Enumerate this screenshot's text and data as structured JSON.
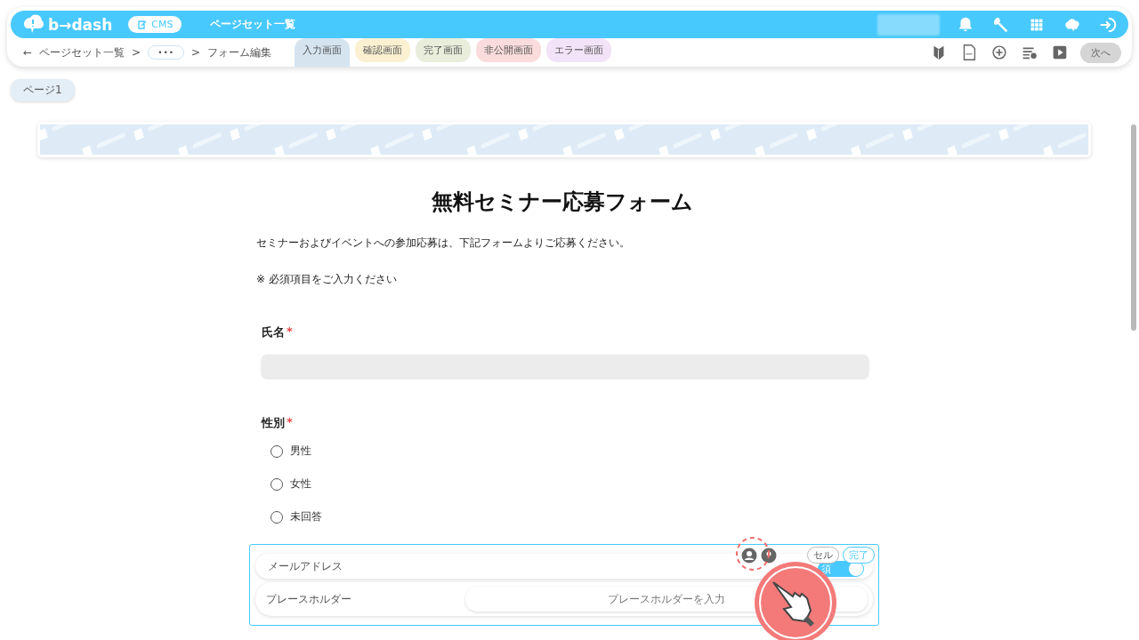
{
  "app_bar": {
    "logo": "b→dash",
    "cms_badge": "CMS",
    "title": "ページセット一覧"
  },
  "breadcrumb": {
    "back": "←",
    "items": [
      {
        "label": "ページセット一覧",
        "kind": "link"
      },
      {
        "label": "•••",
        "kind": "more"
      },
      {
        "label": "フォーム編集",
        "kind": "current"
      }
    ],
    "separator": ">"
  },
  "screen_tabs": [
    {
      "label": "入力画面",
      "selected": true,
      "color": "#d6e4f0"
    },
    {
      "label": "確認画面",
      "selected": false,
      "color": "#fbf1d2"
    },
    {
      "label": "完了画面",
      "selected": false,
      "color": "#e9eedc"
    },
    {
      "label": "非公開画面",
      "selected": false,
      "color": "#fbdcdc"
    },
    {
      "label": "エラー画面",
      "selected": false,
      "color": "#f3e3f8"
    }
  ],
  "next_button": {
    "label": "次へ",
    "disabled": true
  },
  "page_tabs": [
    {
      "label": "ページ1",
      "selected": true
    }
  ],
  "form": {
    "title": "無料セミナー応募フォーム",
    "description": "セミナーおよびイベントへの参加応募は、下記フォームよりご応募ください。",
    "note": "※ 必須項目をご入力ください",
    "fields": [
      {
        "kind": "text",
        "label": "氏名",
        "required_mark": "*"
      },
      {
        "kind": "radio",
        "label": "性別",
        "required_mark": "*",
        "options": [
          {
            "label": "男性",
            "selected": false
          },
          {
            "label": "女性",
            "selected": false
          },
          {
            "label": "未回答",
            "selected": false
          }
        ]
      }
    ],
    "editing": {
      "name_value": "メールアドレス",
      "placeholder_label": "プレースホルダー",
      "placeholder_input": "プレースホルダーを入力",
      "cancel": "セル",
      "done": "完了",
      "required_toggle": {
        "label": "須",
        "on": true
      }
    }
  }
}
